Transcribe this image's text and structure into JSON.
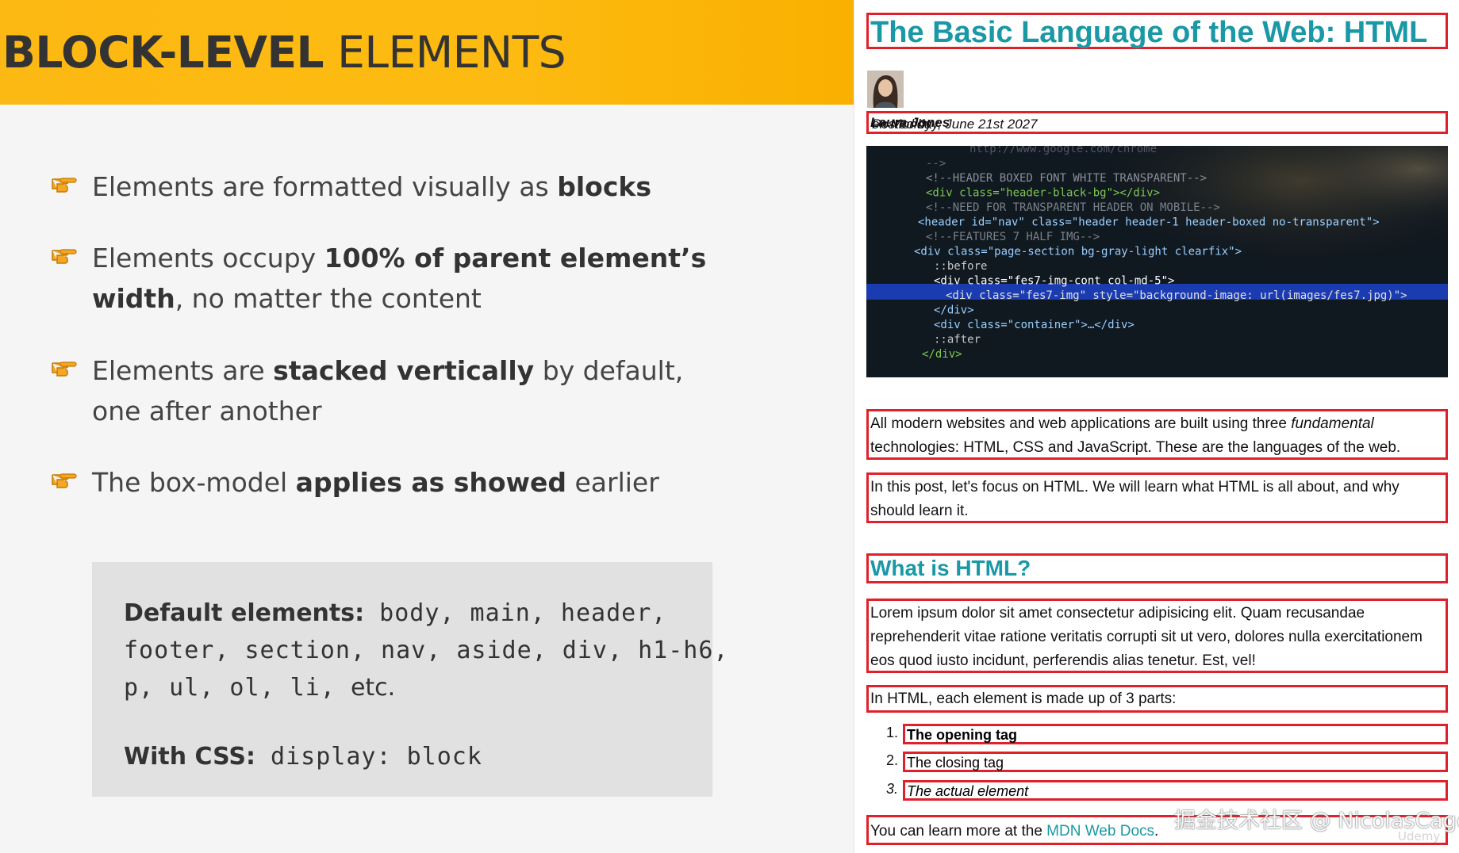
{
  "slide": {
    "title_bold": "BLOCK-LEVEL",
    "title_rest": " ELEMENTS",
    "bullets": [
      {
        "pre": "Elements are formatted visually as ",
        "bold": "blocks",
        "post": ""
      },
      {
        "pre": "Elements occupy ",
        "bold": "100% of parent element’s width",
        "post": ", no matter the content"
      },
      {
        "pre": "Elements are ",
        "bold": "stacked vertically",
        "post": " by default, one after another"
      },
      {
        "pre": "The box-model ",
        "bold": "applies as showed",
        "post": " earlier"
      }
    ],
    "box": {
      "default_label": "Default elements:",
      "default_line1": " body, main, header,",
      "default_line2": "footer, section, nav, aside, div, h1-h6,",
      "default_line3": "p, ul, ol, li, ",
      "default_etc": "etc.",
      "css_label": "With CSS:",
      "css_value": " display: block"
    }
  },
  "article": {
    "title": "The Basic Language of the Web: HTML",
    "byline_pre": "Posted by ",
    "byline_author": "Laura Jones",
    "byline_post": " on Monday, June 21st 2027",
    "p1_a": "All modern websites and web applications are built using three ",
    "p1_em": "fundamental",
    "p1_b": " technologies: HTML, CSS and JavaScript. These are the languages of the web.",
    "p2": "In this post, let's focus on HTML. We will learn what HTML is all about, and why should learn it.",
    "h2": "What is HTML?",
    "p3": "Lorem ipsum dolor sit amet consectetur adipisicing elit. Quam recusandae reprehenderit vitae ratione veritatis corrupti sit ut vero, dolores nulla exercitationem eos quod iusto incidunt, perferendis alias tenetur. Est, vel!",
    "p4": "In HTML, each element is made up of 3 parts:",
    "list": [
      {
        "num": "1.",
        "text": "The opening tag"
      },
      {
        "num": "2.",
        "text": "The closing tag"
      },
      {
        "num": "3.",
        "text": "The actual element"
      }
    ],
    "p5_pre": "You can learn more at the ",
    "p5_link": "MDN Web Docs",
    "p5_post": ".",
    "code_lines": [
      "http://www.google.com/chrome",
      "-->",
      "<!--HEADER BOXED FONT WHITE TRANSPARENT-->",
      "<div class=\"header-black-bg\"></div>",
      "<!--NEED FOR TRANSPARENT HEADER ON MOBILE-->",
      "<header id=\"nav\" class=\"header header-1 header-boxed no-transparent\">",
      "<!--FEATURES 7 HALF IMG-->",
      "<div class=\"page-section bg-gray-light clearfix\">",
      "::before",
      "<div class=\"fes7-img-cont col-md-5\">",
      "<div class=\"fes7-img\" style=\"background-image: url(images/fes7.jpg)\">",
      "</div>",
      "<div class=\"container\">…</div>",
      "::after",
      "</div>"
    ]
  },
  "watermark": "掘金技术社区 @ NicolasCage",
  "watermark_small": "Udemy"
}
